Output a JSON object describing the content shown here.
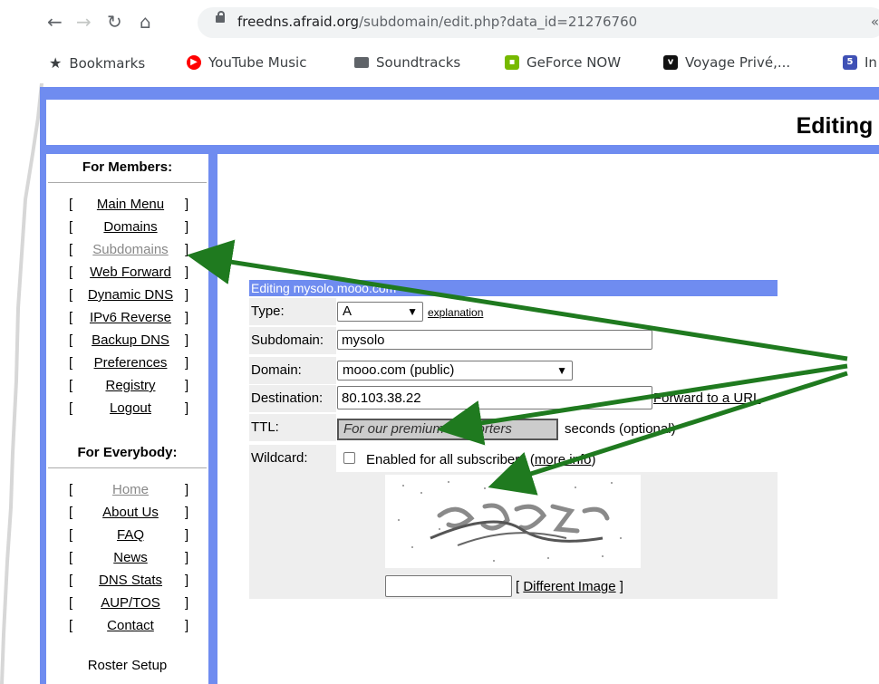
{
  "browser": {
    "url_host": "freedns.afraid.org",
    "url_path": "/subdomain/edit.php?data_id=21276760",
    "bookmarks": [
      {
        "label": "Bookmarks",
        "icon": "star-icon"
      },
      {
        "label": "YouTube Music",
        "icon": "youtube-music-icon",
        "color": "#ff0000"
      },
      {
        "label": "Soundtracks",
        "icon": "folder-icon",
        "color": "#5f6368"
      },
      {
        "label": "GeForce NOW",
        "icon": "geforce-now-icon",
        "color": "#76b900"
      },
      {
        "label": "Voyage Privé,...",
        "icon": "voyage-prive-icon",
        "color": "#111111"
      },
      {
        "label": "In",
        "icon": "html5-icon",
        "color": "#3f51b5"
      }
    ]
  },
  "page": {
    "title": "Editing r",
    "accent_color": "#6f8cf0"
  },
  "sidebar": {
    "members_heading": "For Members:",
    "members_items": [
      {
        "label": "Main Menu",
        "current": false
      },
      {
        "label": "Domains",
        "current": false
      },
      {
        "label": "Subdomains",
        "current": true
      },
      {
        "label": "Web Forward",
        "current": false
      },
      {
        "label": "Dynamic DNS",
        "current": false
      },
      {
        "label": "IPv6 Reverse",
        "current": false
      },
      {
        "label": "Backup DNS",
        "current": false
      },
      {
        "label": "Preferences",
        "current": false
      },
      {
        "label": "Registry",
        "current": false
      },
      {
        "label": "Logout",
        "current": false
      }
    ],
    "everybody_heading": "For Everybody:",
    "everybody_items": [
      {
        "label": "Home",
        "current": true
      },
      {
        "label": "About Us",
        "current": false
      },
      {
        "label": "FAQ",
        "current": false
      },
      {
        "label": "News",
        "current": false
      },
      {
        "label": "DNS Stats",
        "current": false
      },
      {
        "label": "AUP/TOS",
        "current": false
      },
      {
        "label": "Contact",
        "current": false
      }
    ],
    "bracket_left": "[",
    "bracket_right": "]",
    "cut_off_text": "Roster Setup"
  },
  "form": {
    "heading": "Editing mysolo.mooo.com",
    "type_label": "Type:",
    "type_value": "A",
    "explanation_link": "explanation",
    "subdomain_label": "Subdomain:",
    "subdomain_value": "mysolo",
    "domain_label": "Domain:",
    "domain_value": "mooo.com (public)",
    "destination_label": "Destination:",
    "destination_value": "80.103.38.22",
    "forward_link": "Forward to a URL",
    "ttl_label": "TTL:",
    "ttl_value": "For our premium supporters",
    "ttl_suffix": "seconds (optional)",
    "wildcard_label": "Wildcard:",
    "wildcard_text": "Enabled for all subscribers (",
    "wildcard_link": "more info",
    "wildcard_close": ")",
    "captcha_value": "",
    "different_image_link": "Different Image",
    "bracket_left": "[",
    "bracket_right": "]"
  },
  "annotation": {
    "arrow_color": "#1f7a1f"
  }
}
